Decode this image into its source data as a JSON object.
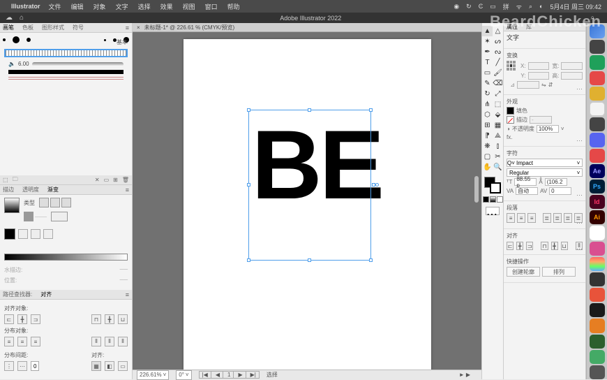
{
  "menubar": {
    "app": "Illustrator",
    "items": [
      "文件",
      "编辑",
      "对象",
      "文字",
      "选择",
      "效果",
      "视图",
      "窗口",
      "帮助"
    ],
    "status_date": "5月4日 周三 09:42"
  },
  "apptoolbar": {
    "title": "Adobe Illustrator 2022"
  },
  "watermark": "BeardChicken",
  "doc_tab": {
    "name": "未标题-1* @ 226.61 % (CMYK/预览)"
  },
  "canvas": {
    "text": "BE"
  },
  "statusbar": {
    "zoom": "226.61%",
    "rotate": "0°",
    "nav": [
      "|◀",
      "◀",
      "1",
      "▶",
      "▶|"
    ],
    "tool": "选择",
    "hint": "► ▶"
  },
  "left_panels": {
    "swatch_tabs": [
      "画笔",
      "色板",
      "图形样式",
      "符号"
    ],
    "basic_label": "基本",
    "stroke_val": "6.00",
    "grad_tabs": [
      "描边",
      "透明度",
      "渐变"
    ],
    "grad_type_label": "类型",
    "grad_disabled": {
      "stroke_label": "水描边:",
      "stroke_val": "──",
      "pos_label": "位置:",
      "pos_val": "──"
    },
    "pf_tabs": [
      "路径查找器:",
      "对齐"
    ],
    "align1": "对齐对象:",
    "align2": "分布对象:",
    "align3": "分布间距:",
    "align4": "对齐:",
    "spacing": "0"
  },
  "tools": [
    "selection",
    "direct",
    "wand",
    "lasso",
    "pen",
    "curvature",
    "type",
    "line",
    "rect",
    "brush",
    "pencil",
    "eraser",
    "rotate",
    "scale",
    "width",
    "free",
    "shapebuilder",
    "perspective",
    "mesh",
    "gradient",
    "eyedrop",
    "blend",
    "symbol",
    "graph",
    "artboard",
    "slice",
    "hand",
    "zoom"
  ],
  "right": {
    "props_tab": "属性",
    "lib_tab": "库",
    "notype": "文字",
    "transform_title": "变换",
    "x": "X:",
    "y": "Y:",
    "w": "宽:",
    "h": "高:",
    "appearance_title": "外观",
    "fill_label": "填色",
    "stroke_label": "描边",
    "stroke_dash": "-",
    "opacity_label": "不透明度",
    "opacity_val": "100%",
    "fx": "fx.",
    "char_title": "字符",
    "font": "Impact",
    "style": "Regular",
    "size": "88.55 p",
    "leading": "(106.2",
    "kern": "自动",
    "tracking": "0",
    "para_title": "段落",
    "align_title": "对齐",
    "quick_title": "快捷操作",
    "btn1": "创建轮廓",
    "btn2": "排列"
  },
  "dock": {
    "ae": "Ae",
    "ps": "Ps",
    "id": "Id",
    "ai": "Ai"
  }
}
